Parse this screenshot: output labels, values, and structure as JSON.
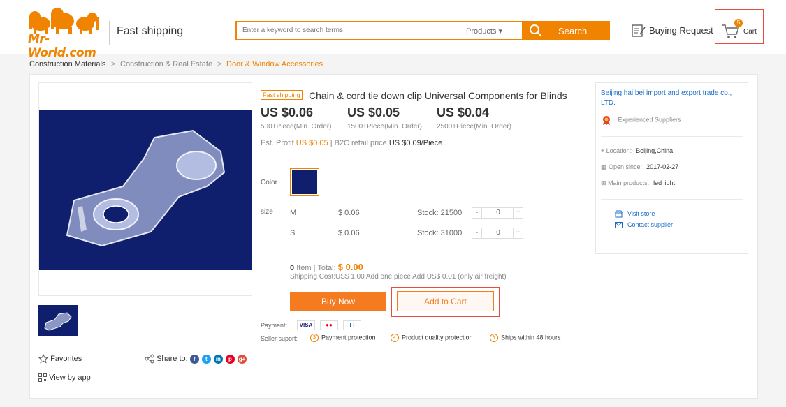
{
  "header": {
    "logo": "Mr-World.com",
    "slogan": "Fast shipping",
    "search_placeholder": "Enter a keyword to search terms",
    "search_category": "Products ▾",
    "search_button": "Search",
    "buying_request": "Buying Request",
    "cart_label": "Cart",
    "cart_count": "5"
  },
  "breadcrumb": [
    "Construction Materials",
    ">",
    "Construction & Real Estate",
    ">",
    "Door & Window Accessories"
  ],
  "product": {
    "tag": "Fast shipping",
    "title": "Chain & cord tie down clip Universal Components for Blinds",
    "prices": [
      {
        "price": "US $0.06",
        "moq": "500+Piece(Min. Order)"
      },
      {
        "price": "US $0.05",
        "moq": "1500+Piece(Min. Order)"
      },
      {
        "price": "US $0.04",
        "moq": "2500+Piece(Min. Order)"
      }
    ],
    "profit_label": "Est. Profit",
    "profit_value": "US $0.05",
    "retail_label": "| B2C retail price",
    "retail_value": "US $0.09/Piece",
    "color_label": "Color",
    "size_label": "size",
    "sizes": [
      {
        "name": "M",
        "price": "$ 0.06",
        "stock": "Stock: 21500",
        "qty": "0"
      },
      {
        "name": "S",
        "price": "$ 0.06",
        "stock": "Stock: 31000",
        "qty": "0"
      }
    ],
    "minus": "-",
    "plus": "+",
    "item_count": "0",
    "item_label": "Item",
    "total_label": "|   Total:",
    "total_value": "$  0.00",
    "shipping": "Shipping Cost:US$ 1.00   Add one piece Add US$ 0.01  (only air freight)",
    "buy_now": "Buy Now",
    "add_to_cart": "Add to Cart",
    "payment_label": "Payment:",
    "payment_methods": [
      "VISA",
      "●●",
      "TT"
    ],
    "seller_support_label": "Seller suport:",
    "supports": [
      "Payment protection",
      "Product quality protection",
      "Ships within 48 hours"
    ]
  },
  "left": {
    "favorites": "Favorites",
    "share": "Share to:",
    "social": [
      "f",
      "t",
      "in",
      "p",
      "g+"
    ],
    "view_by_app": "View by app"
  },
  "supplier": {
    "name": "Beijing hai bei import and export trade co., LTD.",
    "badge": "Experienced Suppliers",
    "location_label": "Location:",
    "location": "Beijing,China",
    "open_label": "Open since:",
    "open": "2017-02-27",
    "main_label": "Main products:",
    "main": "led light",
    "visit": "Visit store",
    "contact": "Contact supplier"
  },
  "colors": {
    "accent": "#f08300",
    "button": "#f47b20",
    "link": "#1a6dc8",
    "highlight": "#e74c3c",
    "product_bg": "#0f1f6d"
  }
}
